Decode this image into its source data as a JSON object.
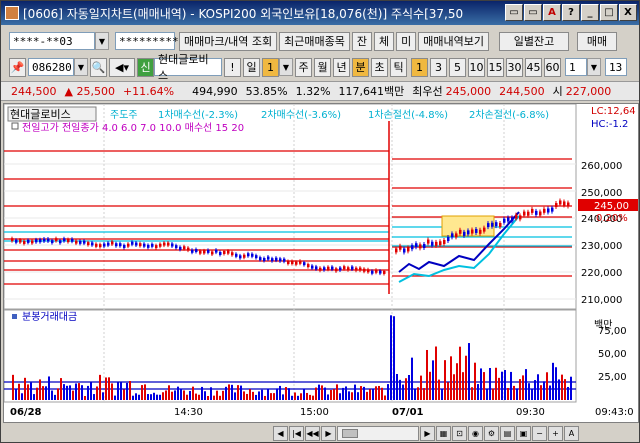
{
  "window": {
    "title": "[0606] 자동일지차트(매매내역) - KOSPI200 외국인보유[18,076(천)] 주식수[37,50",
    "buttons": [
      "▭",
      "▭",
      "A",
      "?",
      "_",
      "□",
      "X"
    ]
  },
  "toolbar1": {
    "account": "****-**03",
    "password": "*********",
    "btn_trade_mark": "매매마크/내역 조회",
    "btn_recent": "최근매매종목",
    "btn_jan": "잔",
    "btn_che": "체",
    "btn_mi": "미",
    "btn_trade_view": "매매내역보기",
    "btn_daily_balance": "일별잔고",
    "btn_more": "매매"
  },
  "toolbar2": {
    "code": "086280",
    "stock_name": "현대글로비스",
    "periods": [
      "일",
      "1",
      "주",
      "월",
      "년",
      "분",
      "초",
      "틱"
    ],
    "period_selected": "분",
    "minutes": [
      "1",
      "3",
      "5",
      "10",
      "15",
      "30",
      "45",
      "60"
    ],
    "minute_selected": "1",
    "count1": "1",
    "count2": "13"
  },
  "quote": {
    "price": "244,500",
    "change": "▲ 25,500",
    "change_pct": "+11.64%",
    "volume": "494,990",
    "ratio": "53.85%",
    "rate": "1.32%",
    "amount": "117,641백만",
    "best_ask_label": "최우선",
    "best_ask": "245,000",
    "best_bid": "244,500",
    "open_label": "시",
    "open": "227,000"
  },
  "chart": {
    "price_legend": "현대글로비스",
    "legend_items": [
      {
        "text": "주도주",
        "color": "#00b0d0"
      },
      {
        "text": "1차매수선(-2.3%)",
        "color": "#00b0d0"
      },
      {
        "text": "2차매수선(-3.6%)",
        "color": "#00b0d0"
      },
      {
        "text": "1차손절선(-4.8%)",
        "color": "#00b0d0"
      },
      {
        "text": "2차손절선(-6.8%)",
        "color": "#00b0d0"
      }
    ],
    "legend2": "전일고가 전일종가 4.0 6.0 7.0 10.0 매수선 15 20",
    "lc_label": "LC:12,64",
    "hc_label": "HC:-1.2",
    "current_price_label": "245,00",
    "current_pct_label": "0.20%",
    "price_axis": [
      "260,000",
      "250,000",
      "240,000",
      "230,000",
      "220,000",
      "210,000"
    ],
    "volume_title": "분봉거래대금",
    "volume_axis": [
      "75,00",
      "50,00",
      "25,00"
    ],
    "volume_unit": "백만",
    "time_axis": [
      "06/28",
      "14:30",
      "15:00",
      "07/01",
      "09:30",
      "09:43:0"
    ],
    "colors": {
      "up": "#e00000",
      "down": "#0000e0",
      "line": "#e00000",
      "cyan": "#00c0e0",
      "navy": "#0000c0"
    }
  }
}
